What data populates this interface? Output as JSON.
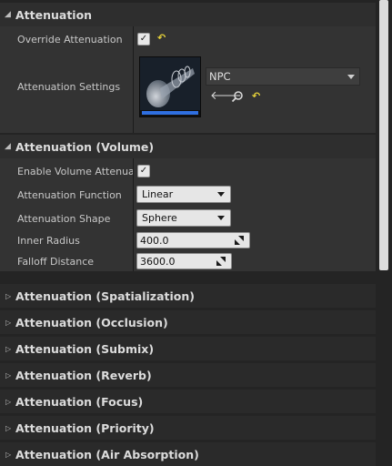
{
  "sections": {
    "attenuation": {
      "title": "Attenuation",
      "override_label": "Override Attenuation",
      "override_checked": true,
      "settings_label": "Attenuation Settings",
      "settings_value": "NPC"
    },
    "volume": {
      "title": "Attenuation (Volume)",
      "enable_label": "Enable Volume Attenuatic",
      "enable_checked": true,
      "function_label": "Attenuation Function",
      "function_value": "Linear",
      "shape_label": "Attenuation Shape",
      "shape_value": "Sphere",
      "inner_radius_label": "Inner Radius",
      "inner_radius_value": "400.0",
      "falloff_label": "Falloff Distance",
      "falloff_value": "3600.0"
    },
    "collapsed": [
      "Attenuation (Spatialization)",
      "Attenuation (Occlusion)",
      "Attenuation (Submix)",
      "Attenuation (Reverb)",
      "Attenuation (Focus)",
      "Attenuation (Priority)",
      "Attenuation (Air Absorption)"
    ]
  },
  "icons": {
    "expanded_arrow": "triangle-down-icon",
    "collapsed_arrow": "triangle-right-icon",
    "reset": "reset-to-default-icon",
    "browse": "use-selected-arrow-icon",
    "find": "magnifier-icon"
  },
  "colors": {
    "reset_accent": "#e6d23a",
    "thumb_accent": "#2f6fe0"
  }
}
